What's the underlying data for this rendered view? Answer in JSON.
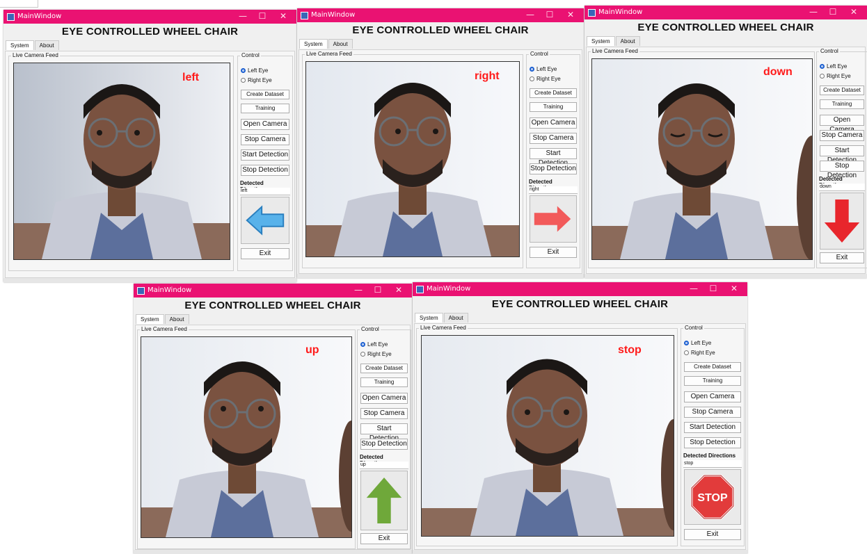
{
  "app": {
    "window_title": "MainWindow",
    "heading": "EYE CONTROLLED WHEEL CHAIR",
    "tabs": [
      "System",
      "About"
    ],
    "feed_label": "Live Camera Feed",
    "control_label": "Control",
    "radio_left": "Left Eye",
    "radio_right": "Right Eye",
    "btn_create": "Create Dataset",
    "btn_training": "Training",
    "btn_open": "Open Camera",
    "btn_stop_cam": "Stop Camera",
    "btn_start_det": "Start Detection",
    "btn_stop_det": "Stop Detection",
    "detected_label": "Detected Directions",
    "btn_exit": "Exit",
    "win_min": "—",
    "win_max": "☐",
    "win_close": "✕"
  },
  "windows": [
    {
      "direction": "left",
      "detected_value": "left",
      "indicator": "left-arrow-icon",
      "indicator_color": "#4aa3e0"
    },
    {
      "direction": "right",
      "detected_value": "right",
      "indicator": "right-arrow-icon",
      "indicator_color": "#f25a5a"
    },
    {
      "direction": "down",
      "detected_value": "down",
      "indicator": "down-arrow-icon",
      "indicator_color": "#e8262c"
    },
    {
      "direction": "up",
      "detected_value": "up",
      "indicator": "up-arrow-icon",
      "indicator_color": "#6fa83a"
    },
    {
      "direction": "stop",
      "detected_value": "stop",
      "indicator": "stop-sign-icon",
      "indicator_color": "#e23b3b"
    }
  ],
  "colors": {
    "titlebar": "#ea1272",
    "overlay_text": "#ff1a1a",
    "radio_selected": "#1c5fd0"
  }
}
